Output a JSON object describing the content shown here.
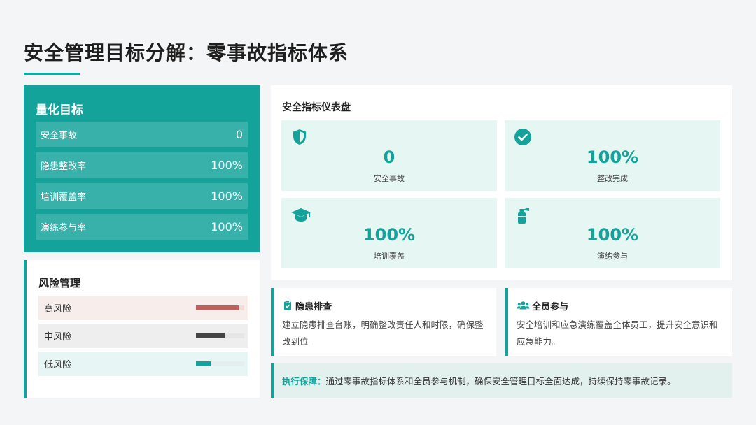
{
  "page": {
    "title": "安全管理目标分解：零事故指标体系"
  },
  "goals": {
    "title": "量化目标",
    "rows": [
      {
        "label": "安全事故",
        "value": "0"
      },
      {
        "label": "隐患整改率",
        "value": "100%"
      },
      {
        "label": "培训覆盖率",
        "value": "100%"
      },
      {
        "label": "演练参与率",
        "value": "100%"
      }
    ]
  },
  "risk": {
    "title": "风险管理",
    "levels": [
      {
        "label": "高风险",
        "level": 0.88,
        "color": "#c0605c"
      },
      {
        "label": "中风险",
        "level": 0.6,
        "color": "#444444"
      },
      {
        "label": "低风险",
        "level": 0.3,
        "color": "#14a39b"
      }
    ]
  },
  "dashboard": {
    "title": "安全指标仪表盘",
    "kpis": [
      {
        "value": "0",
        "caption": "安全事故",
        "icon": "shield-icon"
      },
      {
        "value": "100%",
        "caption": "整改完成",
        "icon": "check-circle-icon"
      },
      {
        "value": "100%",
        "caption": "培训覆盖",
        "icon": "graduation-cap-icon"
      },
      {
        "value": "100%",
        "caption": "演练参与",
        "icon": "fire-extinguisher-icon"
      }
    ]
  },
  "cards": [
    {
      "title": "隐患排查",
      "icon": "clipboard-check-icon",
      "body": "建立隐患排查台账，明确整改责任人和时限，确保整改到位。"
    },
    {
      "title": "全员参与",
      "icon": "users-icon",
      "body": "安全培训和应急演练覆盖全体员工，提升安全意识和应急能力。"
    }
  ],
  "footer": {
    "label": "执行保障：",
    "text": "通过零事故指标体系和全员参与机制，确保安全管理目标全面达成，持续保持零事故记录。"
  },
  "colors": {
    "accent": "#14a39b",
    "kpi_bg": "#e5f6f3",
    "high_risk": "#c0605c"
  }
}
